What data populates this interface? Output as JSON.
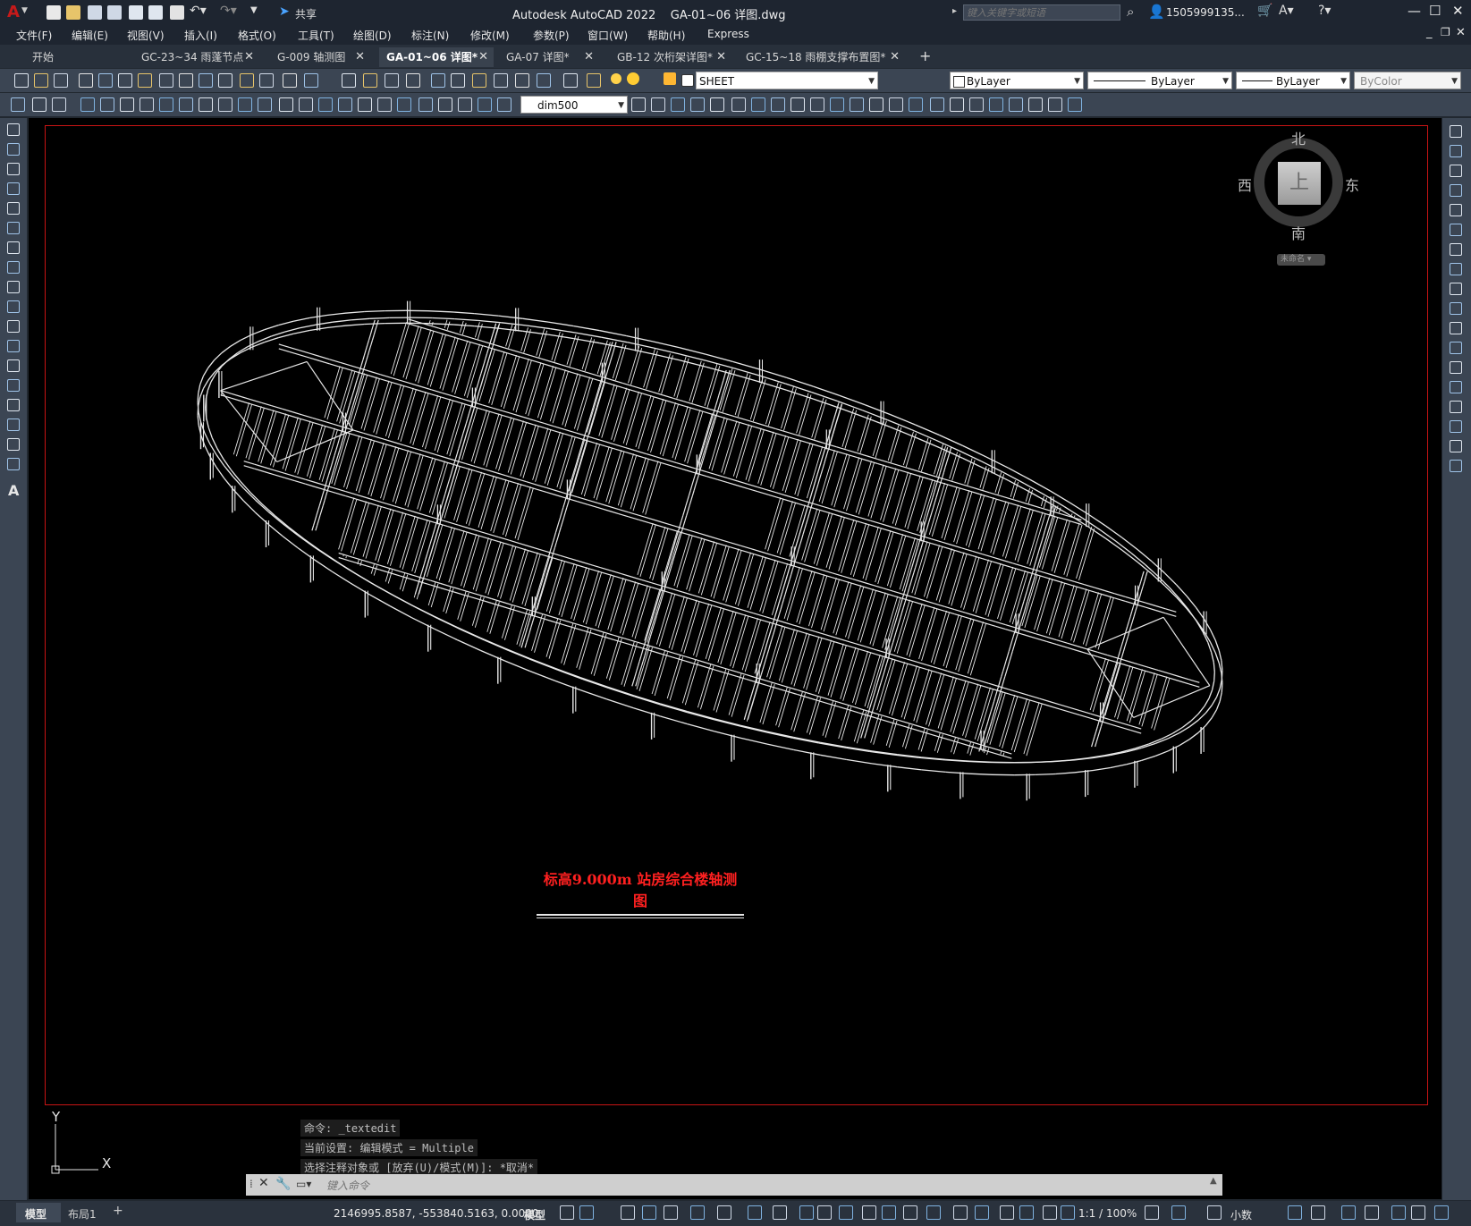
{
  "app": {
    "title": "Autodesk AutoCAD 2022    GA-01~06 详图.dwg",
    "logo": "A",
    "share": "共享",
    "search_placeholder": "键入关键字或短语",
    "user": "1505999135...",
    "accent": "#c61a1a"
  },
  "menu": [
    "文件(F)",
    "编辑(E)",
    "视图(V)",
    "插入(I)",
    "格式(O)",
    "工具(T)",
    "绘图(D)",
    "标注(N)",
    "修改(M)",
    "参数(P)",
    "窗口(W)",
    "帮助(H)",
    "Express"
  ],
  "tabs": [
    {
      "label": "开始",
      "closable": false,
      "active": false
    },
    {
      "label": "GC-23~34 雨蓬节点",
      "closable": true,
      "active": false
    },
    {
      "label": "G-009 轴测图",
      "closable": true,
      "active": false
    },
    {
      "label": "GA-01~06 详图*",
      "closable": true,
      "active": true
    },
    {
      "label": "GA-07 详图*",
      "closable": true,
      "active": false
    },
    {
      "label": "GB-12 次桁架详图*",
      "closable": true,
      "active": false
    },
    {
      "label": "GC-15~18 雨棚支撑布置图*",
      "closable": true,
      "active": false
    }
  ],
  "toolbar": {
    "layer": "SHEET",
    "color": "ByLayer",
    "linetype": "ByLayer",
    "lineweight": "ByLayer",
    "plotstyle": "ByColor",
    "dimstyle": "dim500"
  },
  "viewcube": {
    "north": "北",
    "south": "南",
    "east": "东",
    "west": "西",
    "top": "上",
    "ucs": "未命名"
  },
  "drawing": {
    "caption": "标高9.000m 站房综合楼轴测图",
    "caption_color": "#ff2020",
    "line_color": "#e8e8e8",
    "frame_color": "#c81414"
  },
  "ucs_icon": {
    "y": "Y",
    "x": "X"
  },
  "command": {
    "history": [
      "命令: _textedit",
      "当前设置: 编辑模式 = Multiple",
      "选择注释对象或 [放弃(U)/模式(M)]: *取消*"
    ],
    "placeholder": "键入命令"
  },
  "status": {
    "layout_tabs": [
      "模型",
      "布局1"
    ],
    "coords": "2146995.8587, -553840.5163, 0.0000",
    "mode": "模型",
    "scale": "1:1 / 100%",
    "units": "小数"
  }
}
